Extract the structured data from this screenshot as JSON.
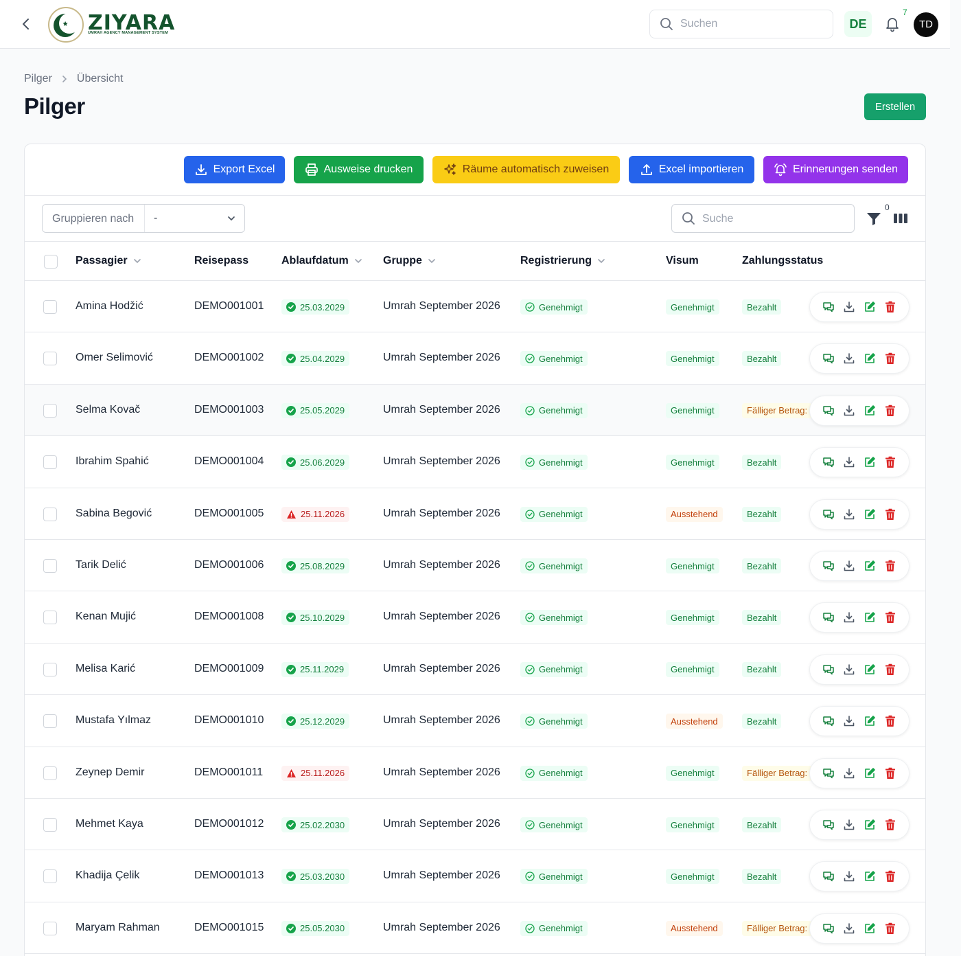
{
  "brand": {
    "name": "ZIYARA",
    "tagline": "UMRAH AGENCY MANAGEMENT SYSTEM"
  },
  "topbar": {
    "search_placeholder": "Suchen",
    "language": "DE",
    "notification_count": "7",
    "user_initials": "TD"
  },
  "breadcrumb": [
    "Pilger",
    "Übersicht"
  ],
  "page_title": "Pilger",
  "create_label": "Erstellen",
  "toolbar": {
    "export_excel": "Export Excel",
    "print_ids": "Ausweise drucken",
    "auto_rooms": "Räume automatisch zuweisen",
    "import_excel": "Excel importieren",
    "send_reminders": "Erinnerungen senden"
  },
  "filters": {
    "group_by_label": "Gruppieren nach",
    "group_by_value": "-",
    "search_placeholder": "Suche",
    "active_filter_count": "0"
  },
  "columns": [
    "Passagier",
    "Reisepass",
    "Ablaufdatum",
    "Gruppe",
    "Registrierung",
    "Visum",
    "Zahlungsstatus"
  ],
  "rows": [
    {
      "name": "Amina Hodžić",
      "passport": "DEMO001001",
      "expiry": "25.03.2029",
      "expiry_ok": true,
      "group": "Umrah September 2026",
      "registration": "Genehmigt",
      "visa": "Genehmigt",
      "visa_state": "approved",
      "payment": "Bezahlt",
      "payment_state": "paid"
    },
    {
      "name": "Omer Selimović",
      "passport": "DEMO001002",
      "expiry": "25.04.2029",
      "expiry_ok": true,
      "group": "Umrah September 2026",
      "registration": "Genehmigt",
      "visa": "Genehmigt",
      "visa_state": "approved",
      "payment": "Bezahlt",
      "payment_state": "paid"
    },
    {
      "name": "Selma Kovač",
      "passport": "DEMO001003",
      "expiry": "25.05.2029",
      "expiry_ok": true,
      "group": "Umrah September 2026",
      "registration": "Genehmigt",
      "visa": "Genehmigt",
      "visa_state": "approved",
      "payment": "Fälliger Betrag:",
      "payment_state": "due"
    },
    {
      "name": "Ibrahim Spahić",
      "passport": "DEMO001004",
      "expiry": "25.06.2029",
      "expiry_ok": true,
      "group": "Umrah September 2026",
      "registration": "Genehmigt",
      "visa": "Genehmigt",
      "visa_state": "approved",
      "payment": "Bezahlt",
      "payment_state": "paid"
    },
    {
      "name": "Sabina Begović",
      "passport": "DEMO001005",
      "expiry": "25.11.2026",
      "expiry_ok": false,
      "group": "Umrah September 2026",
      "registration": "Genehmigt",
      "visa": "Ausstehend",
      "visa_state": "pending",
      "payment": "Bezahlt",
      "payment_state": "paid"
    },
    {
      "name": "Tarik Delić",
      "passport": "DEMO001006",
      "expiry": "25.08.2029",
      "expiry_ok": true,
      "group": "Umrah September 2026",
      "registration": "Genehmigt",
      "visa": "Genehmigt",
      "visa_state": "approved",
      "payment": "Bezahlt",
      "payment_state": "paid"
    },
    {
      "name": "Kenan Mujić",
      "passport": "DEMO001008",
      "expiry": "25.10.2029",
      "expiry_ok": true,
      "group": "Umrah September 2026",
      "registration": "Genehmigt",
      "visa": "Genehmigt",
      "visa_state": "approved",
      "payment": "Bezahlt",
      "payment_state": "paid"
    },
    {
      "name": "Melisa Karić",
      "passport": "DEMO001009",
      "expiry": "25.11.2029",
      "expiry_ok": true,
      "group": "Umrah September 2026",
      "registration": "Genehmigt",
      "visa": "Genehmigt",
      "visa_state": "approved",
      "payment": "Bezahlt",
      "payment_state": "paid"
    },
    {
      "name": "Mustafa Yılmaz",
      "passport": "DEMO001010",
      "expiry": "25.12.2029",
      "expiry_ok": true,
      "group": "Umrah September 2026",
      "registration": "Genehmigt",
      "visa": "Ausstehend",
      "visa_state": "pending",
      "payment": "Bezahlt",
      "payment_state": "paid"
    },
    {
      "name": "Zeynep Demir",
      "passport": "DEMO001011",
      "expiry": "25.11.2026",
      "expiry_ok": false,
      "group": "Umrah September 2026",
      "registration": "Genehmigt",
      "visa": "Genehmigt",
      "visa_state": "approved",
      "payment": "Fälliger Betrag:",
      "payment_state": "due"
    },
    {
      "name": "Mehmet Kaya",
      "passport": "DEMO001012",
      "expiry": "25.02.2030",
      "expiry_ok": true,
      "group": "Umrah September 2026",
      "registration": "Genehmigt",
      "visa": "Genehmigt",
      "visa_state": "approved",
      "payment": "Bezahlt",
      "payment_state": "paid"
    },
    {
      "name": "Khadija Çelik",
      "passport": "DEMO001013",
      "expiry": "25.03.2030",
      "expiry_ok": true,
      "group": "Umrah September 2026",
      "registration": "Genehmigt",
      "visa": "Genehmigt",
      "visa_state": "approved",
      "payment": "Bezahlt",
      "payment_state": "paid"
    },
    {
      "name": "Maryam Rahman",
      "passport": "DEMO001015",
      "expiry": "25.05.2030",
      "expiry_ok": true,
      "group": "Umrah September 2026",
      "registration": "Genehmigt",
      "visa": "Ausstehend",
      "visa_state": "pending",
      "payment": "Fälliger Betrag:",
      "payment_state": "due"
    }
  ]
}
